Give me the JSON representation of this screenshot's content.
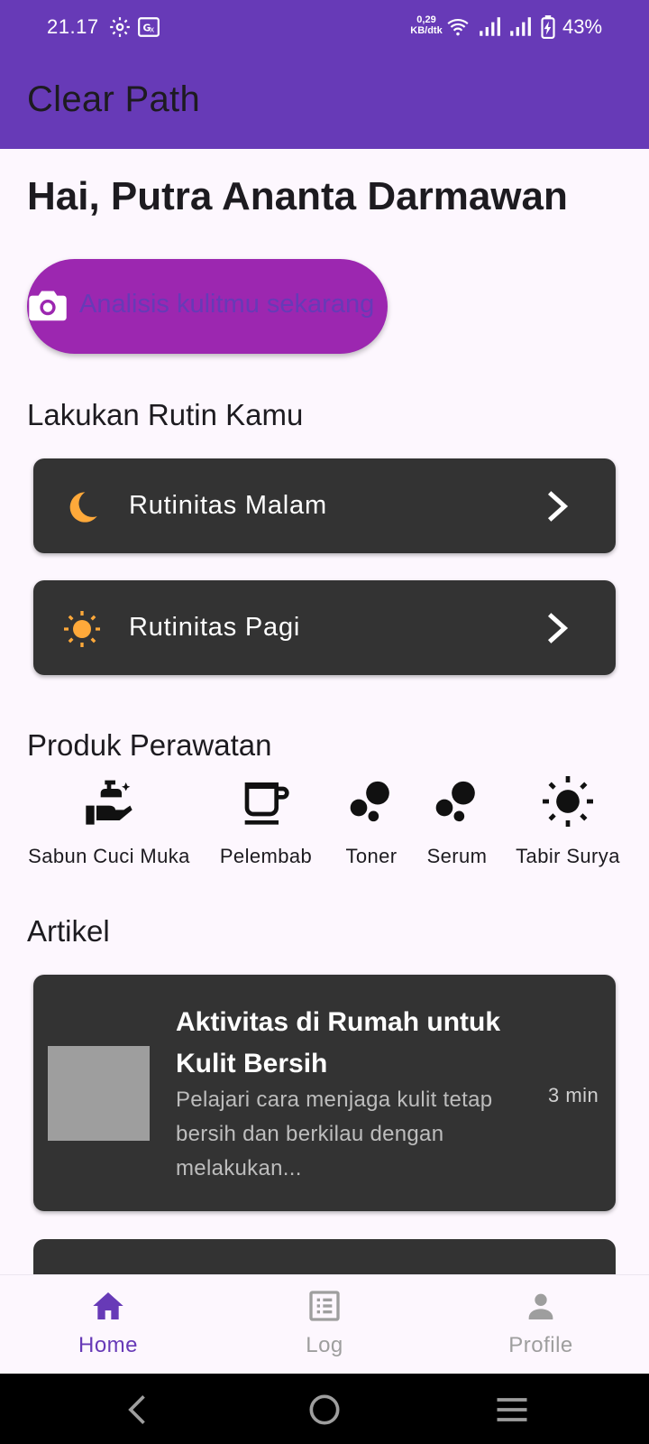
{
  "status_bar": {
    "time": "21.17",
    "network_speed_value": "0,29",
    "network_speed_unit": "KB/dtk",
    "battery_percent": "43%"
  },
  "app_bar": {
    "title": "Clear Path"
  },
  "greeting": "Hai, Putra Ananta Darmawan",
  "analyze_button": {
    "label": "Analisis kulitmu sekarang",
    "icon": "camera-icon"
  },
  "routine_section": {
    "title": "Lakukan Rutin Kamu",
    "items": [
      {
        "label": "Rutinitas Malam",
        "icon": "moon-icon"
      },
      {
        "label": "Rutinitas Pagi",
        "icon": "sun-icon"
      }
    ]
  },
  "products_section": {
    "title": "Produk Perawatan",
    "items": [
      {
        "label": "Sabun Cuci Muka",
        "icon": "face-wash-icon"
      },
      {
        "label": "Pelembab",
        "icon": "cup-icon"
      },
      {
        "label": "Toner",
        "icon": "bubbles-icon"
      },
      {
        "label": "Serum",
        "icon": "bubbles-icon"
      },
      {
        "label": "Tabir Surya",
        "icon": "sun-icon"
      }
    ]
  },
  "articles_section": {
    "title": "Artikel",
    "items": [
      {
        "title": "Aktivitas di Rumah untuk Kulit Bersih",
        "description": "Pelajari cara menjaga kulit tetap bersih dan berkilau dengan melakukan...",
        "read_time": "3 min"
      }
    ]
  },
  "bottom_nav": {
    "items": [
      {
        "label": "Home",
        "icon": "home-icon",
        "active": true
      },
      {
        "label": "Log",
        "icon": "list-icon",
        "active": false
      },
      {
        "label": "Profile",
        "icon": "person-icon",
        "active": false
      }
    ]
  },
  "colors": {
    "primary": "#673ab7",
    "accent_button": "#9c27b0",
    "card": "#333333",
    "routine_icon": "#ffa93a",
    "nav_inactive": "#9e9e9e"
  }
}
